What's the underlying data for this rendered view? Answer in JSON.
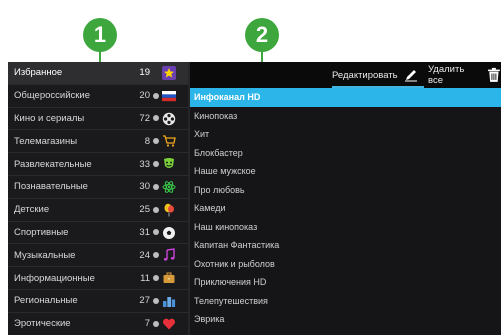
{
  "callouts": {
    "first": "1",
    "second": "2"
  },
  "categories": [
    {
      "name": "Избранное",
      "count": "19",
      "icon": "star-icon",
      "selected": true
    },
    {
      "name": "Общероссийские",
      "count": "20",
      "icon": "russian-flag-icon"
    },
    {
      "name": "Кино и сериалы",
      "count": "72",
      "icon": "film-reel-icon"
    },
    {
      "name": "Телемагазины",
      "count": "8",
      "icon": "shopping-cart-icon"
    },
    {
      "name": "Развлекательные",
      "count": "33",
      "icon": "theater-masks-icon"
    },
    {
      "name": "Познавательные",
      "count": "30",
      "icon": "atom-icon"
    },
    {
      "name": "Детские",
      "count": "25",
      "icon": "balloon-icon"
    },
    {
      "name": "Спортивные",
      "count": "31",
      "icon": "soccer-ball-icon"
    },
    {
      "name": "Музыкальные",
      "count": "24",
      "icon": "music-note-icon"
    },
    {
      "name": "Информационные",
      "count": "11",
      "icon": "briefcase-icon"
    },
    {
      "name": "Региональные",
      "count": "27",
      "icon": "city-buildings-icon"
    },
    {
      "name": "Эротические",
      "count": "7",
      "icon": "heart-icon"
    }
  ],
  "toolbar": {
    "edit_label": "Редактировать",
    "delete_label": "Удалить все"
  },
  "channels": [
    {
      "name": "Инфоканал HD",
      "selected": true
    },
    {
      "name": "Кинопоказ"
    },
    {
      "name": "Хит"
    },
    {
      "name": "Блокбастер"
    },
    {
      "name": "Наше мужское"
    },
    {
      "name": "Про любовь"
    },
    {
      "name": "Камеди"
    },
    {
      "name": "Наш кинопоказ"
    },
    {
      "name": "Капитан Фантастика"
    },
    {
      "name": "Охотник и рыболов"
    },
    {
      "name": "Приключения HD"
    },
    {
      "name": "Телепутешествия"
    },
    {
      "name": "Эврика"
    }
  ],
  "colors": {
    "accent": "#2cb5e8",
    "callout": "#3da63d",
    "background": "#0d0d0f"
  }
}
